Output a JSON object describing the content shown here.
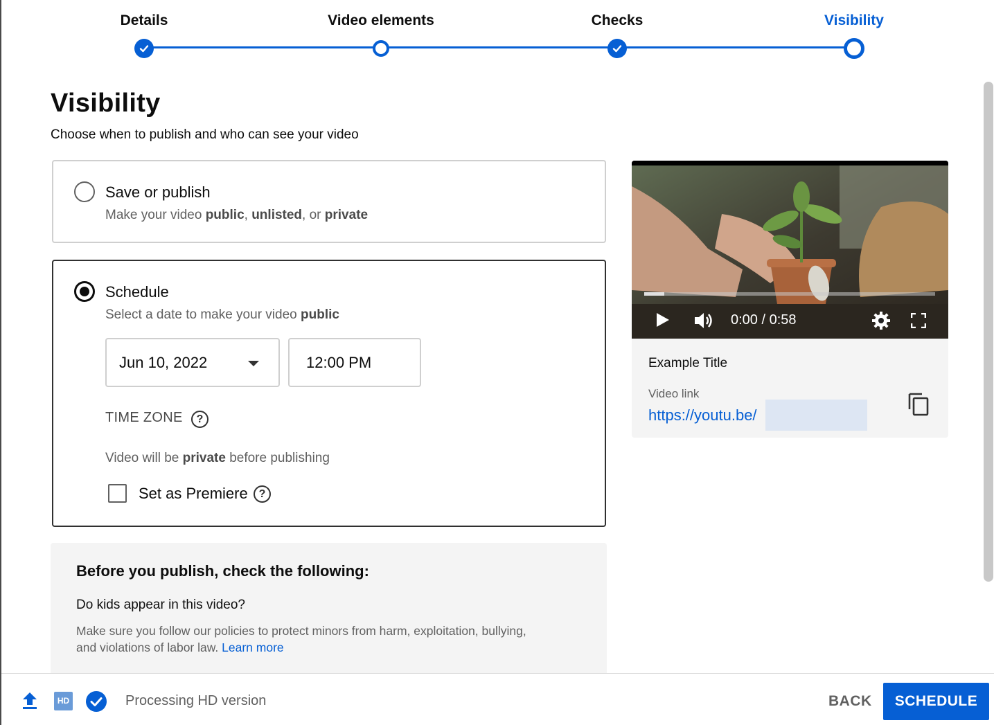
{
  "stepper": {
    "steps": [
      {
        "label": "Details",
        "state": "done"
      },
      {
        "label": "Video elements",
        "state": "open"
      },
      {
        "label": "Checks",
        "state": "done"
      },
      {
        "label": "Visibility",
        "state": "current"
      }
    ]
  },
  "header": {
    "title": "Visibility",
    "subtitle": "Choose when to publish and who can see your video"
  },
  "save_option": {
    "title": "Save or publish",
    "desc_prefix": "Make your video ",
    "desc_public": "public",
    "desc_sep1": ", ",
    "desc_unlisted": "unlisted",
    "desc_sep2": ", or ",
    "desc_private": "private",
    "selected": false
  },
  "schedule_option": {
    "title": "Schedule",
    "desc_prefix": "Select a date to make your video ",
    "desc_public": "public",
    "selected": true,
    "date_value": "Jun 10, 2022",
    "time_value": "12:00 PM",
    "timezone_label": "TIME ZONE",
    "note_prefix": "Video will be ",
    "note_private": "private",
    "note_suffix": " before publishing",
    "premiere_label": "Set as Premiere",
    "premiere_checked": false
  },
  "checklist": {
    "title": "Before you publish, check the following:",
    "question": "Do kids appear in this video?",
    "body": "Make sure you follow our policies to protect minors from harm, exploitation, bullying, and violations of labor law.",
    "link": "Learn more"
  },
  "preview": {
    "time": "0:00 / 0:58",
    "progress": 0.07,
    "title": "Example Title",
    "link_label": "Video link",
    "link_url": "https://youtu.be/"
  },
  "footer": {
    "status": "Processing HD version",
    "hd_badge": "HD",
    "back_label": "BACK",
    "schedule_label": "SCHEDULE"
  },
  "colors": {
    "accent": "#065fd4",
    "text": "#0d0d0d",
    "secondary_text": "#606060"
  },
  "icons": [
    "check-icon",
    "help-icon",
    "dropdown-arrow-icon",
    "play-icon",
    "volume-icon",
    "settings-icon",
    "fullscreen-icon",
    "copy-icon",
    "upload-icon",
    "hd-icon",
    "processed-check-icon"
  ]
}
